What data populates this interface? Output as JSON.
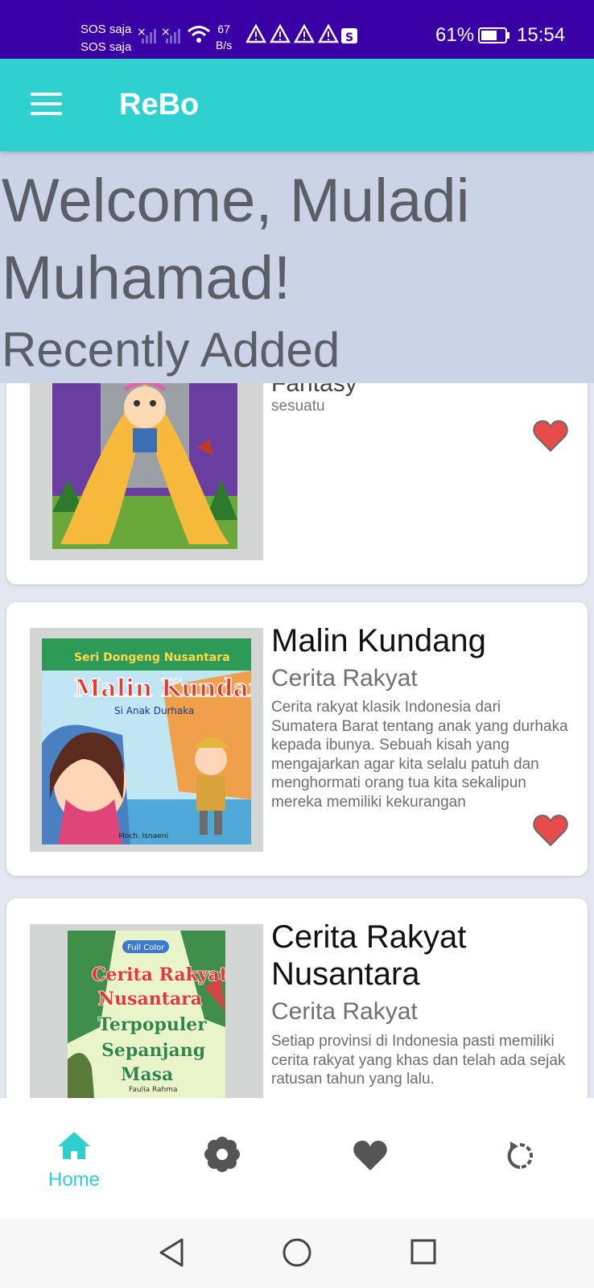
{
  "status_bar": {
    "sim1": "SOS saja",
    "sim2": "SOS saja",
    "net_speed_value": "67",
    "net_speed_unit": "B/s",
    "battery": "61%",
    "time": "15:54"
  },
  "app_bar": {
    "title": "ReBo",
    "menu_icon": "menu-icon"
  },
  "header": {
    "welcome": "Welcome, Muladi Muhamad!",
    "section_title": "Recently Added"
  },
  "books": [
    {
      "title": "Fantasy",
      "genre": "sesuatu",
      "description": "",
      "favorite": true
    },
    {
      "title": "Malin Kundang",
      "genre": "Cerita Rakyat",
      "description": "Cerita rakyat klasik Indonesia dari Sumatera Barat tentang anak yang durhaka kepada ibunya. Sebuah kisah yang mengajarkan agar kita selalu patuh dan menghormati orang tua kita sekalipun mereka memiliki kekurangan",
      "favorite": true
    },
    {
      "title": "Cerita Rakyat Nusantara",
      "genre": "Cerita Rakyat",
      "description": "Setiap provinsi di Indonesia pasti memiliki cerita rakyat yang khas dan telah ada sejak ratusan tahun yang lalu.",
      "favorite": true
    }
  ],
  "covers": {
    "malin_series": "Seri Dongeng Nusantara",
    "malin_title": "Malin Kundang",
    "malin_subtitle": "Si Anak Durhaka",
    "malin_author": "Moch. Isnaeni",
    "crn_badge": "Full Color",
    "crn_line1": "Cerita Rakyat",
    "crn_line2": "Nusantara",
    "crn_line3": "Terpopuler",
    "crn_line4": "Sepanjang",
    "crn_line5": "Masa",
    "crn_author": "Faulia Rahma"
  },
  "bottom_nav": {
    "items": [
      {
        "label": "Home",
        "icon": "home-icon",
        "active": true
      },
      {
        "label": "",
        "icon": "flower-icon",
        "active": false
      },
      {
        "label": "",
        "icon": "heart-icon",
        "active": false
      },
      {
        "label": "",
        "icon": "refresh-icon",
        "active": false
      }
    ]
  },
  "colors": {
    "status_bar": "#3a00a5",
    "app_bar": "#2fd0d0",
    "header_bg": "#cbd4e6",
    "favorite": "#e84b4b",
    "nav_active": "#2fcfcf",
    "nav_inactive": "#555555"
  }
}
